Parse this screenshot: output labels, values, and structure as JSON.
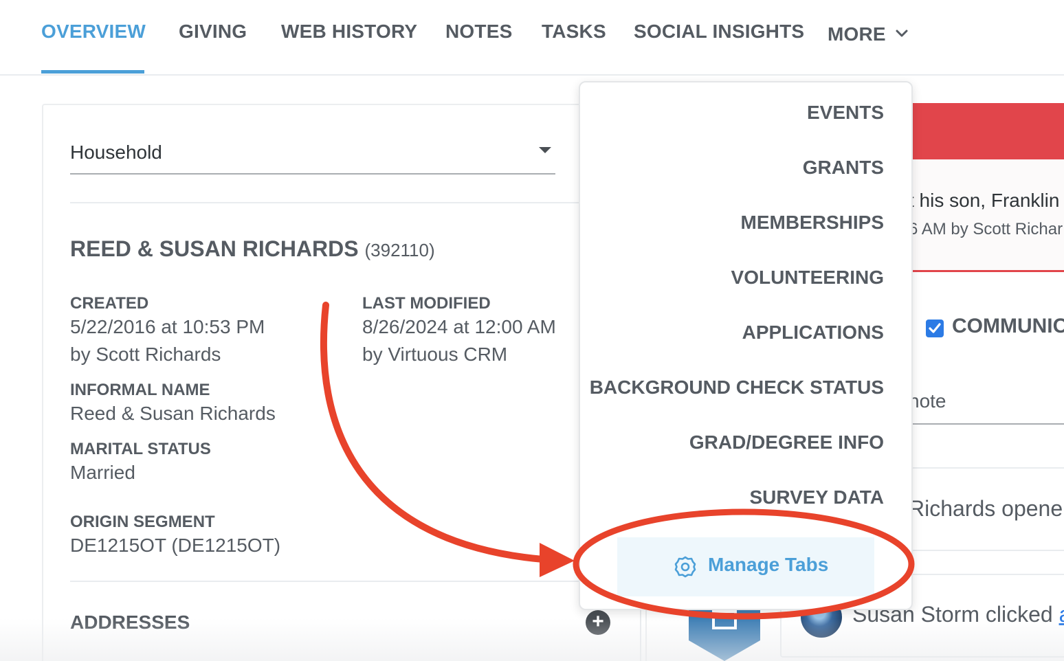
{
  "tabs": [
    {
      "label": "OVERVIEW",
      "active": true
    },
    {
      "label": "GIVING"
    },
    {
      "label": "WEB HISTORY"
    },
    {
      "label": "NOTES"
    },
    {
      "label": "TASKS"
    },
    {
      "label": "SOCIAL INSIGHTS"
    },
    {
      "label": "MORE",
      "icon": "chevron-down-icon"
    }
  ],
  "colors": {
    "accent": "#4b9fd8",
    "alert": "#e1454b",
    "annotation": "#e8432b",
    "checkbox": "#2c7be5"
  },
  "profile": {
    "view_select": "Household",
    "name": "REED & SUSAN RICHARDS",
    "id": "(392110)",
    "created_label": "CREATED",
    "created_value": "5/22/2016 at 10:53 PM",
    "created_by": "by Scott Richards",
    "modified_label": "LAST MODIFIED",
    "modified_value": "8/26/2024 at 12:00 AM",
    "modified_by": "by Virtuous CRM",
    "informal_label": "INFORMAL NAME",
    "informal_value": "Reed & Susan Richards",
    "marital_label": "MARITAL STATUS",
    "marital_value": "Married",
    "origin_label": "ORIGIN SEGMENT",
    "origin_value": "DE1215OT (DE1215OT)",
    "addresses_label": "ADDRESSES"
  },
  "right_panel": {
    "note_text": "t his son, Franklin",
    "note_meta": "6 AM by Scott Richar",
    "communication_label": "COMMUNIC",
    "note_placeholder": "note",
    "feed_1": "Richards opene",
    "feed_2_prefix": "Susan Storm clicked ",
    "feed_2_link": "a"
  },
  "more_menu": {
    "items": [
      "EVENTS",
      "GRANTS",
      "MEMBERSHIPS",
      "VOLUNTEERING",
      "APPLICATIONS",
      "BACKGROUND CHECK STATUS",
      "GRAD/DEGREE INFO",
      "SURVEY DATA"
    ],
    "manage_label": "Manage Tabs",
    "manage_icon": "gear-icon"
  }
}
